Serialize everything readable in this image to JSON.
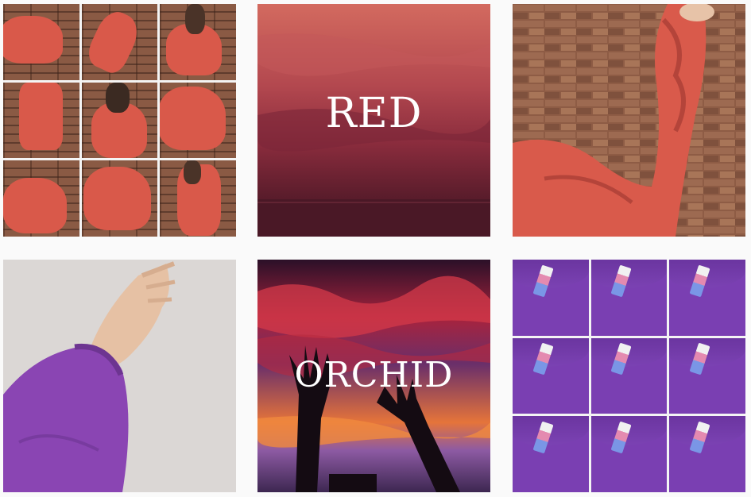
{
  "feed": {
    "posts": [
      {
        "id": "p1",
        "kind": "collage",
        "overlay": ""
      },
      {
        "id": "p2",
        "kind": "text-overlay",
        "overlay": "RED"
      },
      {
        "id": "p3",
        "kind": "photo",
        "overlay": ""
      },
      {
        "id": "p4",
        "kind": "photo",
        "overlay": ""
      },
      {
        "id": "p5",
        "kind": "text-overlay",
        "overlay": "ORCHID"
      },
      {
        "id": "p6",
        "kind": "collage",
        "overlay": ""
      }
    ]
  },
  "colors": {
    "background": "#fafafa",
    "red_sweater": "#d9594a",
    "orchid_sweater": "#7a3fb2",
    "red_sky": "#b3484f",
    "brick": "#8a5a44"
  }
}
